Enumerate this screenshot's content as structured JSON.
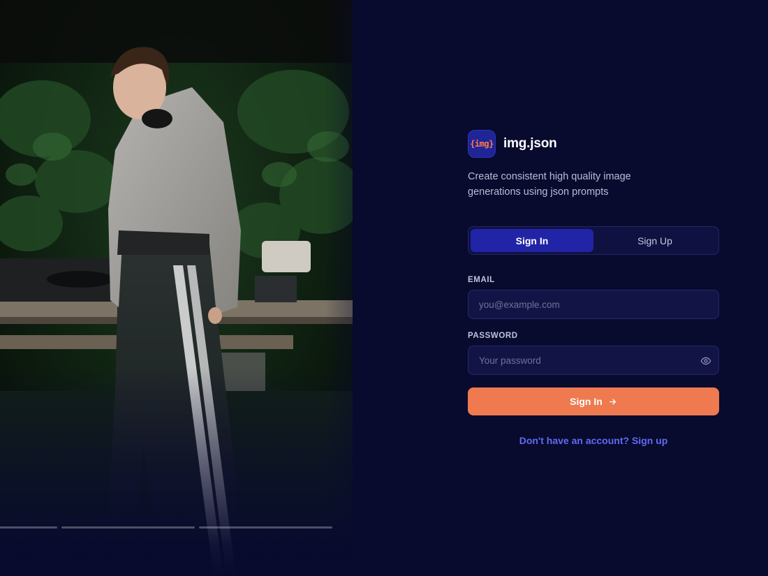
{
  "hero": {
    "image_description_icon": "photo-icon",
    "slides": {
      "count": 3,
      "active": 1
    }
  },
  "brand": {
    "logo_text": "{img}",
    "name": "img.json",
    "tagline": "Create consistent high quality image generations using json prompts"
  },
  "tabs": [
    {
      "label": "Sign In",
      "active": true
    },
    {
      "label": "Sign Up",
      "active": false
    }
  ],
  "form": {
    "email": {
      "label": "EMAIL",
      "placeholder": "you@example.com",
      "value": ""
    },
    "password": {
      "label": "PASSWORD",
      "placeholder": "Your password",
      "value": "",
      "toggle_icon": "eye-icon"
    },
    "submit_label": "Sign In",
    "submit_icon": "arrow-right-icon",
    "switch_link": "Don't have an account? Sign up"
  },
  "colors": {
    "background": "#080a2e",
    "accent": "#ef7a4f",
    "tab_active": "#2124a6",
    "link": "#5f6cf0"
  }
}
